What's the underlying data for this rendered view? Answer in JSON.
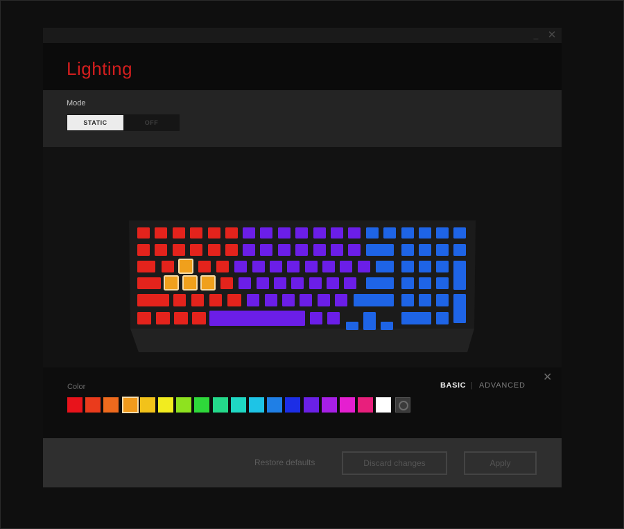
{
  "window": {
    "minimize_glyph": "_",
    "close_glyph": "✕"
  },
  "header": {
    "title": "Lighting"
  },
  "mode": {
    "label": "Mode",
    "options": [
      "STATIC",
      "OFF"
    ],
    "selected": "STATIC"
  },
  "colors": {
    "label": "Color",
    "tabs": {
      "basic": "BASIC",
      "separator": "|",
      "advanced": "ADVANCED",
      "active": "basic"
    },
    "close_glyph": "✕",
    "swatches": [
      "#e8131b",
      "#ea3b1c",
      "#ee6a1d",
      "#f09a1d",
      "#f2c21a",
      "#f2ec1f",
      "#8ee21f",
      "#2ed83a",
      "#24d98a",
      "#1fd8c3",
      "#1ec4e6",
      "#1f7fe6",
      "#1c2ee6",
      "#6a20e6",
      "#a61fe6",
      "#e51fd0",
      "#e81f7c",
      "#ffffff"
    ],
    "selected_index": 3,
    "rainbow_icon": "rainbow-cycle-icon"
  },
  "keyboard": {
    "colors": {
      "red": "#e4231c",
      "purple": "#6b1ee8",
      "blue": "#1e64e6",
      "orange": "#f0a01c",
      "highlight_border": "#f7dba6",
      "case": "#1b1b1b"
    },
    "selected_keys": [
      "W",
      "A",
      "S",
      "D"
    ]
  },
  "footer": {
    "restore_label": "Restore defaults",
    "discard_label": "Discard changes",
    "apply_label": "Apply"
  }
}
